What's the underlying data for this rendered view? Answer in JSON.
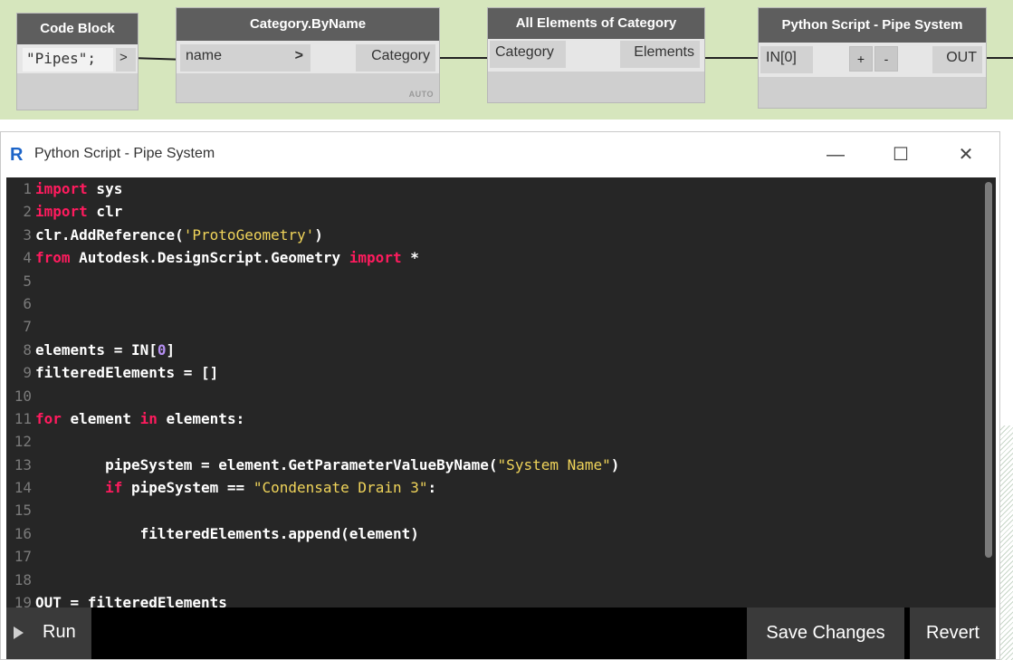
{
  "nodes": {
    "code_block": {
      "title": "Code Block",
      "code": "\"Pipes\";",
      "out_port": ">"
    },
    "category_by_name": {
      "title": "Category.ByName",
      "input": "name",
      "input_arrow": ">",
      "output": "Category",
      "lacing": "AUTO"
    },
    "all_elements": {
      "title": "All Elements of Category",
      "input": "Category",
      "output": "Elements"
    },
    "python_script": {
      "title": "Python Script - Pipe System",
      "input": "IN[0]",
      "add": "+",
      "remove": "-",
      "output": "OUT"
    }
  },
  "editor": {
    "app_icon": "R",
    "title": "Python Script - Pipe System",
    "minimize": "—",
    "maximize": "☐",
    "close": "✕",
    "lines": [
      {
        "n": "1",
        "tokens": [
          {
            "t": "import",
            "c": "kw"
          },
          {
            "t": " sys",
            "c": ""
          }
        ]
      },
      {
        "n": "2",
        "tokens": [
          {
            "t": "import",
            "c": "kw"
          },
          {
            "t": " clr",
            "c": ""
          }
        ]
      },
      {
        "n": "3",
        "tokens": [
          {
            "t": "clr.AddReference(",
            "c": ""
          },
          {
            "t": "'ProtoGeometry'",
            "c": "str"
          },
          {
            "t": ")",
            "c": ""
          }
        ]
      },
      {
        "n": "4",
        "tokens": [
          {
            "t": "from",
            "c": "kw"
          },
          {
            "t": " Autodesk.DesignScript.Geometry ",
            "c": ""
          },
          {
            "t": "import",
            "c": "kw"
          },
          {
            "t": " *",
            "c": ""
          }
        ]
      },
      {
        "n": "5",
        "tokens": []
      },
      {
        "n": "6",
        "tokens": []
      },
      {
        "n": "7",
        "tokens": []
      },
      {
        "n": "8",
        "tokens": [
          {
            "t": "elements = IN[",
            "c": ""
          },
          {
            "t": "0",
            "c": "num"
          },
          {
            "t": "]",
            "c": ""
          }
        ]
      },
      {
        "n": "9",
        "tokens": [
          {
            "t": "filteredElements = []",
            "c": ""
          }
        ]
      },
      {
        "n": "10",
        "tokens": []
      },
      {
        "n": "11",
        "tokens": [
          {
            "t": "for",
            "c": "kw"
          },
          {
            "t": " element ",
            "c": ""
          },
          {
            "t": "in",
            "c": "kw"
          },
          {
            "t": " elements:",
            "c": ""
          }
        ]
      },
      {
        "n": "12",
        "tokens": []
      },
      {
        "n": "13",
        "tokens": [
          {
            "t": "        pipeSystem = element.GetParameterValueByName(",
            "c": ""
          },
          {
            "t": "\"System Name\"",
            "c": "str"
          },
          {
            "t": ")",
            "c": ""
          }
        ]
      },
      {
        "n": "14",
        "tokens": [
          {
            "t": "        ",
            "c": ""
          },
          {
            "t": "if",
            "c": "kw"
          },
          {
            "t": " pipeSystem == ",
            "c": ""
          },
          {
            "t": "\"Condensate Drain 3\"",
            "c": "str"
          },
          {
            "t": ":",
            "c": ""
          }
        ]
      },
      {
        "n": "15",
        "tokens": []
      },
      {
        "n": "16",
        "tokens": [
          {
            "t": "            filteredElements.append(element)",
            "c": ""
          }
        ]
      },
      {
        "n": "17",
        "tokens": []
      },
      {
        "n": "18",
        "tokens": []
      },
      {
        "n": "19",
        "tokens": [
          {
            "t": "OUT = filteredElements",
            "c": ""
          }
        ]
      }
    ],
    "run_label": "Run",
    "save_label": "Save Changes",
    "revert_label": "Revert"
  },
  "colors": {
    "canvas": "#d6e6bd",
    "node_header": "#5e5e5e",
    "code_bg": "#262626",
    "keyword": "#ff1b5e",
    "string": "#f0d45a",
    "number": "#b48ef0"
  }
}
